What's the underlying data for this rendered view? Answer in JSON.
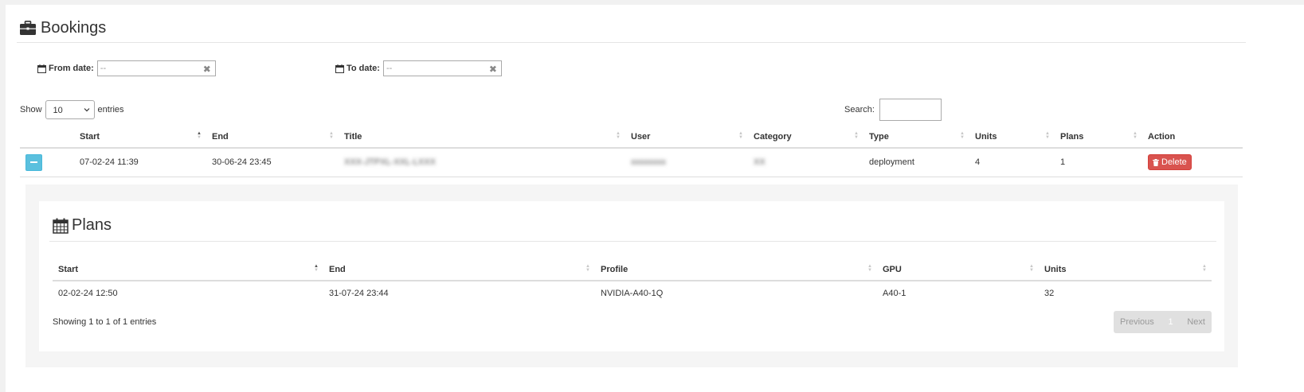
{
  "header": {
    "title": "Bookings",
    "icon": "briefcase-icon"
  },
  "filters": {
    "from_label": "From date:",
    "from_placeholder": "--",
    "to_label": "To date:",
    "to_placeholder": "--",
    "clear_glyph": "✖"
  },
  "length": {
    "show": "Show",
    "value": "10",
    "entries": "entries"
  },
  "search": {
    "label": "Search:"
  },
  "bookings": {
    "columns": [
      "Start",
      "End",
      "Title",
      "User",
      "Category",
      "Type",
      "Units",
      "Plans",
      "Action"
    ],
    "rows": [
      {
        "start": "07-02-24 11:39",
        "end": "30-06-24 23:45",
        "title": "XXX-JTPXL-XXL-LXXX",
        "user": "xxxxxxxx",
        "category": "XX",
        "type": "deployment",
        "units": "4",
        "plans": "1",
        "action": "Delete"
      }
    ]
  },
  "plans": {
    "title": "Plans",
    "icon": "calendar-icon",
    "columns": [
      "Start",
      "End",
      "Profile",
      "GPU",
      "Units"
    ],
    "rows": [
      {
        "start": "02-02-24 12:50",
        "end": "31-07-24 23:44",
        "profile": "NVIDIA-A40-1Q",
        "gpu": "A40-1",
        "units": "32"
      }
    ],
    "info": "Showing 1 to 1 of 1 entries",
    "pager": {
      "previous": "Previous",
      "page": "1",
      "next": "Next"
    }
  },
  "colors": {
    "info_button": "#5bc0de",
    "danger_button": "#d9534f"
  }
}
